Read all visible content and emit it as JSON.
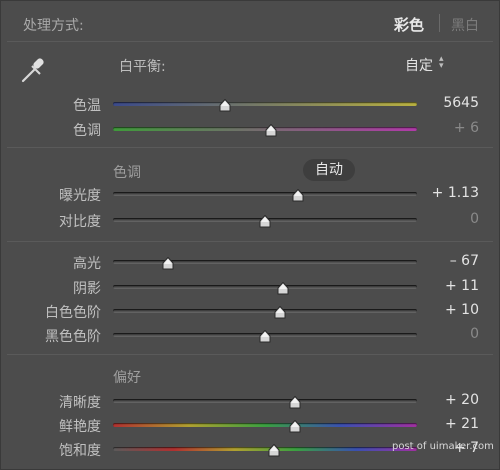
{
  "header": {
    "title": "处理方式:",
    "mode_color": "彩色",
    "mode_bw": "黑白"
  },
  "white_balance": {
    "label": "白平衡:",
    "value": "自定",
    "icon": "eyedropper-icon"
  },
  "sliders_wb": [
    {
      "label": "色温",
      "value": "5645",
      "position": 0.37
    },
    {
      "label": "色调",
      "value": "+ 6",
      "position": 0.52
    }
  ],
  "tone": {
    "section_label": "色调",
    "auto_label": "自动"
  },
  "sliders_tone1": [
    {
      "label": "曝光度",
      "value": "+ 1.13",
      "position": 0.61
    },
    {
      "label": "对比度",
      "value": "0",
      "position": 0.5
    }
  ],
  "sliders_tone2": [
    {
      "label": "高光",
      "value": "– 67",
      "position": 0.18
    },
    {
      "label": "阴影",
      "value": "+ 11",
      "position": 0.56
    },
    {
      "label": "白色色阶",
      "value": "+ 10",
      "position": 0.55
    },
    {
      "label": "黑色色阶",
      "value": "0",
      "position": 0.5
    }
  ],
  "presence": {
    "section_label": "偏好"
  },
  "sliders_presence": [
    {
      "label": "清晰度",
      "value": "+ 20",
      "position": 0.6
    },
    {
      "label": "鲜艳度",
      "value": "+ 21",
      "position": 0.6
    },
    {
      "label": "饱和度",
      "value": "+ 7",
      "position": 0.53
    }
  ],
  "watermark": "post of uimaker.com",
  "colors": {
    "panel_bg": "#4c4c4c",
    "active_text": "#e8e8e8",
    "temp_gradient": [
      "#3b4a8a",
      "#b8b040"
    ],
    "tint_gradient": [
      "#3f9a3a",
      "#b03aa8"
    ],
    "vibrance_gradient": [
      "#b03030",
      "#b0a030",
      "#3aa040",
      "#3a50b0",
      "#a030a0"
    ],
    "saturation_gradient": [
      "#5a5a5a",
      "#b03030",
      "#b0a030",
      "#3aa040",
      "#3a50b0",
      "#a030a0"
    ]
  }
}
